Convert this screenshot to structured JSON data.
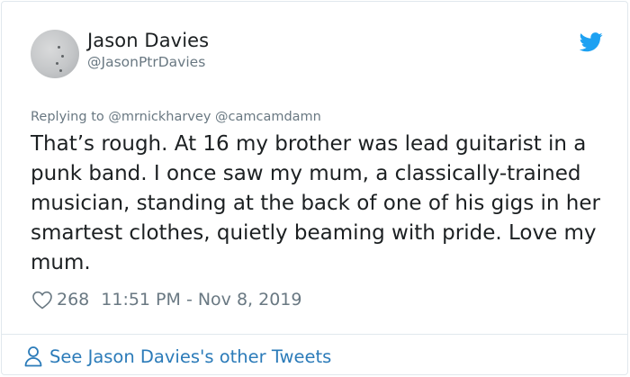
{
  "author": {
    "display_name": "Jason Davies",
    "handle": "@JasonPtrDavies"
  },
  "reply": {
    "text": "Replying to @mrnickharvey @camcamdamn"
  },
  "tweet": {
    "text": "That’s rough. At 16 my brother was lead guitarist in a punk band. I once saw my mum, a classically-trained musician, standing at the back of one of his gigs in her smartest clothes, quietly beaming with pride. Love my mum."
  },
  "meta": {
    "likes": "268",
    "timestamp": "11:51 PM - Nov 8, 2019"
  },
  "footer": {
    "see_more_label": "See Jason Davies's other Tweets"
  },
  "icons": {
    "brand": "twitter-bird-icon",
    "like": "heart-icon",
    "profile": "person-icon"
  },
  "colors": {
    "brand_blue": "#1da1f2",
    "link_blue": "#2b7bb9",
    "muted_text": "#697882",
    "body_text": "#1c2022",
    "border": "#e1e8ed"
  }
}
